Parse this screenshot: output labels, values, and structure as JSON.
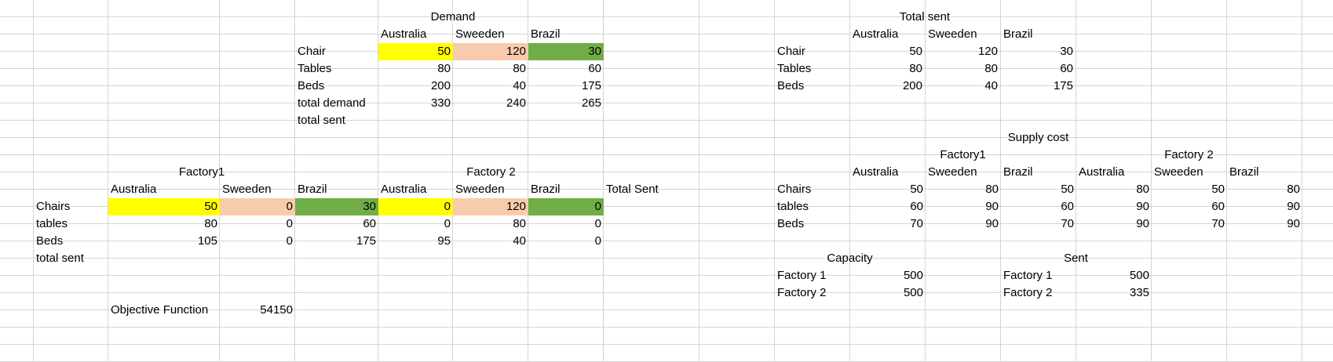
{
  "colors": {
    "yellow": "#ffff00",
    "peach": "#f8cbad",
    "green": "#70ad47",
    "gridline": "#d4d4d4"
  },
  "demand": {
    "title": "Demand",
    "cols": [
      "Australia",
      "Sweeden",
      "Brazil"
    ],
    "rows": [
      {
        "label": "Chair",
        "values": [
          "50",
          "120",
          "30"
        ]
      },
      {
        "label": "Tables",
        "values": [
          "80",
          "80",
          "60"
        ]
      },
      {
        "label": "Beds",
        "values": [
          "200",
          "40",
          "175"
        ]
      },
      {
        "label": "total demand",
        "values": [
          "330",
          "240",
          "265"
        ]
      },
      {
        "label": "total sent",
        "values": [
          "",
          "",
          ""
        ]
      }
    ]
  },
  "total_sent_table": {
    "title": "Total sent",
    "cols": [
      "Australia",
      "Sweeden",
      "Brazil"
    ],
    "rows": [
      {
        "label": "Chair",
        "values": [
          "50",
          "120",
          "30"
        ]
      },
      {
        "label": "Tables",
        "values": [
          "80",
          "80",
          "60"
        ]
      },
      {
        "label": "Beds",
        "values": [
          "200",
          "40",
          "175"
        ]
      }
    ]
  },
  "factories": {
    "factory1": "Factory1",
    "factory2": "Factory 2",
    "cols": [
      "Australia",
      "Sweeden",
      "Brazil",
      "Australia",
      "Sweeden",
      "Brazil"
    ],
    "total_sent_header": "Total Sent",
    "rows": [
      {
        "label": "Chairs",
        "values": [
          "50",
          "0",
          "30",
          "0",
          "120",
          "0"
        ]
      },
      {
        "label": "tables",
        "values": [
          "80",
          "0",
          "60",
          "0",
          "80",
          "0"
        ]
      },
      {
        "label": "Beds",
        "values": [
          "105",
          "0",
          "175",
          "95",
          "40",
          "0"
        ]
      },
      {
        "label": "total sent",
        "values": [
          "",
          "",
          "",
          "",
          "",
          ""
        ]
      }
    ]
  },
  "objective": {
    "label": "Objective Function",
    "value": "54150"
  },
  "supply_cost": {
    "title": "Supply cost",
    "factory1": "Factory1",
    "factory2": "Factory 2",
    "cols": [
      "Australia",
      "Sweeden",
      "Brazil",
      "Australia",
      "Sweeden",
      "Brazil"
    ],
    "rows": [
      {
        "label": "Chairs",
        "values": [
          "50",
          "80",
          "50",
          "80",
          "50",
          "80"
        ]
      },
      {
        "label": "tables",
        "values": [
          "60",
          "90",
          "60",
          "90",
          "60",
          "90"
        ]
      },
      {
        "label": "Beds",
        "values": [
          "70",
          "90",
          "70",
          "90",
          "70",
          "90"
        ]
      }
    ]
  },
  "capacity": {
    "title": "Capacity",
    "rows": [
      {
        "label": "Factory 1",
        "value": "500"
      },
      {
        "label": "Factory 2",
        "value": "500"
      }
    ]
  },
  "sent": {
    "title": "Sent",
    "rows": [
      {
        "label": "Factory 1",
        "value": "500"
      },
      {
        "label": "Factory 2",
        "value": "335"
      }
    ]
  }
}
